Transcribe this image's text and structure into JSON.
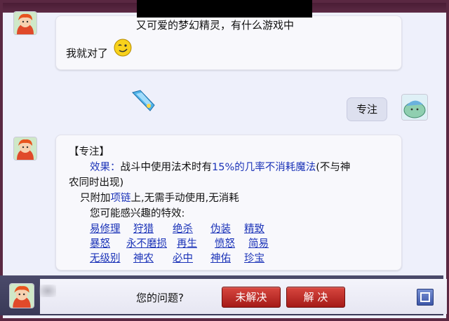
{
  "chat": {
    "msg1_line1": "又可爱的梦幻精灵，有什么游戏中",
    "msg1_line2": "我就对了",
    "user_msg": "专注",
    "skill": {
      "title": "【专注】",
      "effect_label": "效果：",
      "effect_text1": "战斗中使用法术时有",
      "effect_highlight": "15%的几率不消耗魔法",
      "effect_text2": "(不与神",
      "effect_text3": "农同时出现)",
      "attach_prefix": "只附加",
      "attach_item": "项链",
      "attach_suffix": "上,无需手动使用,无消耗",
      "interest_label": "您可能感兴趣的特效:",
      "links": [
        [
          "易修理",
          "狩猎",
          "绝杀",
          "伪装",
          "精致"
        ],
        [
          "暴怒",
          "永不磨损",
          "再生",
          "愤怒",
          "简易"
        ],
        [
          "无级别",
          "神农",
          "必中",
          "神佑",
          "珍宝"
        ]
      ]
    }
  },
  "bottom": {
    "question": "您的问题?",
    "unsolved": "未解决",
    "solved": "解 决"
  }
}
